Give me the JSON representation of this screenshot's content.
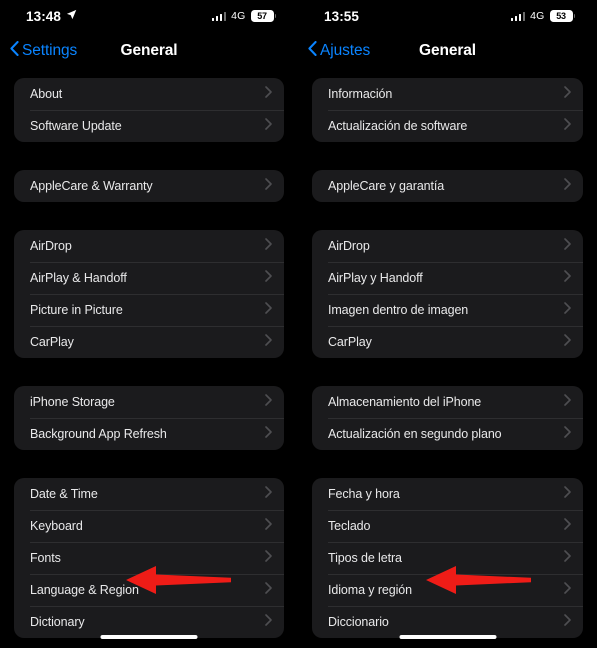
{
  "panels": [
    {
      "name": "english-panel",
      "status_bar": {
        "time": "13:48",
        "location_icon": "location-arrow-icon",
        "signal_icon": "cellular-bars-icon",
        "network": "4G",
        "battery_percent": "57"
      },
      "nav": {
        "back_icon": "chevron-left-icon",
        "back_label": "Settings",
        "title": "General"
      },
      "groups": [
        {
          "rows": [
            {
              "label": "About",
              "chevron": "chevron-right-icon"
            },
            {
              "label": "Software Update",
              "chevron": "chevron-right-icon"
            }
          ]
        },
        {
          "rows": [
            {
              "label": "AppleCare & Warranty",
              "chevron": "chevron-right-icon"
            }
          ]
        },
        {
          "rows": [
            {
              "label": "AirDrop",
              "chevron": "chevron-right-icon"
            },
            {
              "label": "AirPlay & Handoff",
              "chevron": "chevron-right-icon"
            },
            {
              "label": "Picture in Picture",
              "chevron": "chevron-right-icon"
            },
            {
              "label": "CarPlay",
              "chevron": "chevron-right-icon"
            }
          ]
        },
        {
          "rows": [
            {
              "label": "iPhone Storage",
              "chevron": "chevron-right-icon"
            },
            {
              "label": "Background App Refresh",
              "chevron": "chevron-right-icon"
            }
          ]
        },
        {
          "rows": [
            {
              "label": "Date & Time",
              "chevron": "chevron-right-icon"
            },
            {
              "label": "Keyboard",
              "chevron": "chevron-right-icon"
            },
            {
              "label": "Fonts",
              "chevron": "chevron-right-icon"
            },
            {
              "label": "Language & Region",
              "chevron": "chevron-right-icon"
            },
            {
              "label": "Dictionary",
              "chevron": "chevron-right-icon"
            }
          ]
        }
      ],
      "annotation": {
        "icon": "red-left-arrow-annotation",
        "points_at": "Language & Region"
      }
    },
    {
      "name": "spanish-panel",
      "status_bar": {
        "time": "13:55",
        "location_icon": "",
        "signal_icon": "cellular-bars-icon",
        "network": "4G",
        "battery_percent": "53"
      },
      "nav": {
        "back_icon": "chevron-left-icon",
        "back_label": "Ajustes",
        "title": "General"
      },
      "groups": [
        {
          "rows": [
            {
              "label": "Información",
              "chevron": "chevron-right-icon"
            },
            {
              "label": "Actualización de software",
              "chevron": "chevron-right-icon"
            }
          ]
        },
        {
          "rows": [
            {
              "label": "AppleCare y garantía",
              "chevron": "chevron-right-icon"
            }
          ]
        },
        {
          "rows": [
            {
              "label": "AirDrop",
              "chevron": "chevron-right-icon"
            },
            {
              "label": "AirPlay y Handoff",
              "chevron": "chevron-right-icon"
            },
            {
              "label": "Imagen dentro de imagen",
              "chevron": "chevron-right-icon"
            },
            {
              "label": "CarPlay",
              "chevron": "chevron-right-icon"
            }
          ]
        },
        {
          "rows": [
            {
              "label": "Almacenamiento del iPhone",
              "chevron": "chevron-right-icon"
            },
            {
              "label": "Actualización en segundo plano",
              "chevron": "chevron-right-icon"
            }
          ]
        },
        {
          "rows": [
            {
              "label": "Fecha y hora",
              "chevron": "chevron-right-icon"
            },
            {
              "label": "Teclado",
              "chevron": "chevron-right-icon"
            },
            {
              "label": "Tipos de letra",
              "chevron": "chevron-right-icon"
            },
            {
              "label": "Idioma y región",
              "chevron": "chevron-right-icon"
            },
            {
              "label": "Diccionario",
              "chevron": "chevron-right-icon"
            }
          ]
        }
      ],
      "annotation": {
        "icon": "red-left-arrow-annotation",
        "points_at": "Idioma y región"
      }
    }
  ],
  "colors": {
    "background": "#000000",
    "card": "#1b1b1d",
    "separator": "#2e2e30",
    "accent_blue": "#0a84ff",
    "label": "#e9e9ea",
    "annotation_red": "#ef1c17"
  }
}
